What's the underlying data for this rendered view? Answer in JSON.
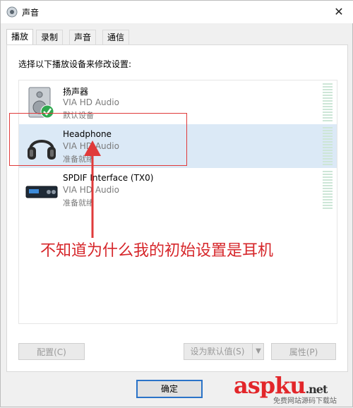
{
  "window": {
    "title": "声音",
    "close_glyph": "✕"
  },
  "tabs": [
    {
      "label": "播放",
      "active": true
    },
    {
      "label": "录制",
      "active": false
    },
    {
      "label": "声音",
      "active": false
    },
    {
      "label": "通信",
      "active": false
    }
  ],
  "instruction": "选择以下播放设备来修改设置:",
  "devices": [
    {
      "name": "扬声器",
      "driver": "VIA HD Audio",
      "status": "默认设备",
      "icon": "speaker-icon",
      "default": true,
      "selected": false
    },
    {
      "name": "Headphone",
      "driver": "VIA HD Audio",
      "status": "准备就绪",
      "icon": "headphone-icon",
      "default": false,
      "selected": true
    },
    {
      "name": "SPDIF Interface (TX0)",
      "driver": "VIA HD Audio",
      "status": "准备就绪",
      "icon": "spdif-device-icon",
      "default": false,
      "selected": false
    }
  ],
  "annotation": {
    "text": "不知道为什么我的初始设置是耳机",
    "color": "#d6262a"
  },
  "buttons": {
    "configure": "配置(C)",
    "set_default": "设为默认值(S)",
    "properties": "属性(P)",
    "ok": "确定"
  },
  "watermark": {
    "main": "aspku",
    "suffix": ".net",
    "sub": "免费网站源码下载站"
  },
  "colors": {
    "selection": "#dbe9f6",
    "accent": "#2a73c8"
  }
}
